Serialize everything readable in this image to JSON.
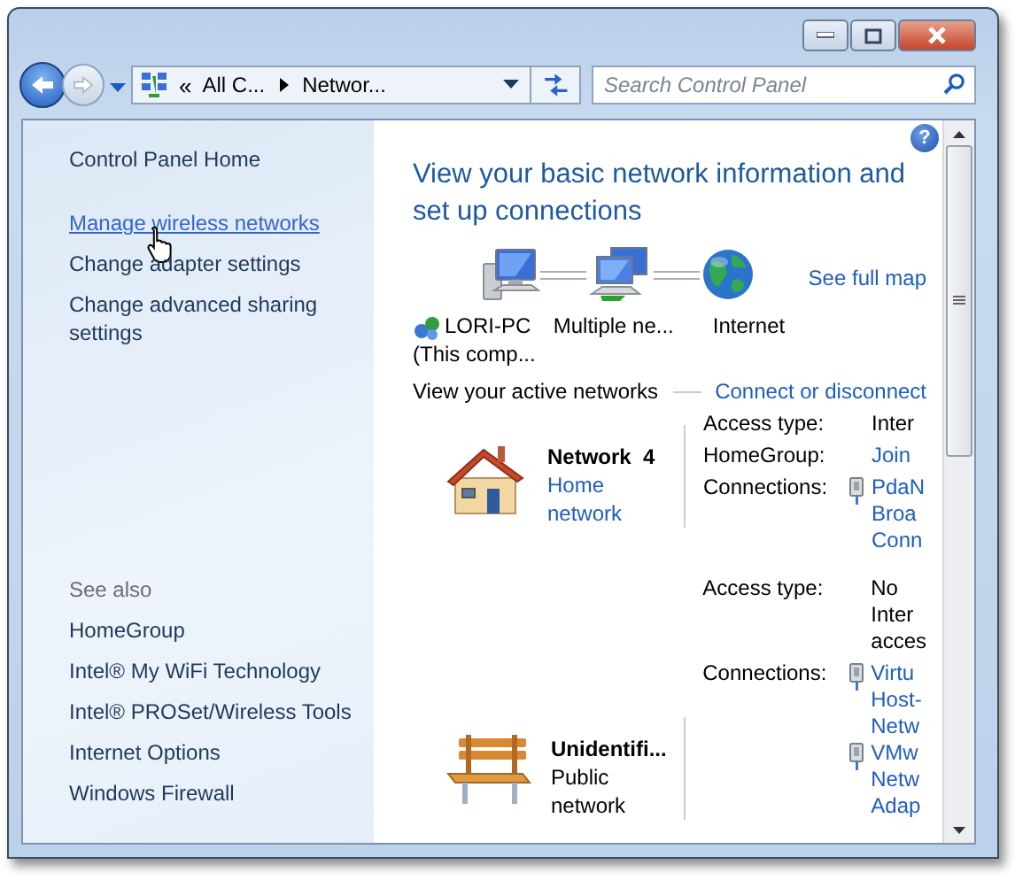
{
  "address_bar": {
    "overflow": "«",
    "crumbs": [
      "All C...",
      "Networ..."
    ]
  },
  "search": {
    "placeholder": "Search Control Panel"
  },
  "help": "?",
  "sidebar": {
    "items": [
      {
        "label": "Control Panel Home",
        "hovered": false
      },
      {
        "label": "Manage wireless networks",
        "hovered": true
      },
      {
        "label": "Change adapter settings",
        "hovered": false
      },
      {
        "label": "Change advanced sharing settings",
        "hovered": false
      }
    ],
    "see_also": {
      "heading": "See also",
      "items": [
        "HomeGroup",
        "Intel® My WiFi Technology",
        "Intel® PROSet/Wireless Tools",
        "Internet Options",
        "Windows Firewall"
      ]
    }
  },
  "main": {
    "title": "View your basic network information and set up connections",
    "map": {
      "nodes": [
        {
          "kind": "computer",
          "lines": [
            "LORI-PC",
            "(This comp..."
          ]
        },
        {
          "kind": "networks",
          "lines": [
            "Multiple ne..."
          ]
        },
        {
          "kind": "internet",
          "lines": [
            "Internet"
          ]
        }
      ],
      "full_map_link": "See full map"
    },
    "active": {
      "heading": "View your active networks",
      "link": "Connect or disconnect"
    },
    "networks": [
      {
        "kind": "home",
        "name": "Network  4",
        "type": "Home network",
        "type_is_link": true,
        "details": [
          {
            "label": "Access type:",
            "entries": [
              {
                "kind": "text",
                "lines": [
                  "Inter"
                ]
              }
            ]
          },
          {
            "label": "HomeGroup:",
            "entries": [
              {
                "kind": "link",
                "lines": [
                  "Join"
                ]
              }
            ]
          },
          {
            "label": "Connections:",
            "entries": [
              {
                "kind": "adapter",
                "lines": [
                  "PdaN",
                  "Broa",
                  "Conn"
                ]
              }
            ]
          }
        ]
      },
      {
        "kind": "public",
        "name": "Unidentifi...",
        "type": "Public network",
        "type_is_link": false,
        "details": [
          {
            "label": "Access type:",
            "entries": [
              {
                "kind": "text",
                "lines": [
                  "No",
                  "Inter",
                  "acces"
                ]
              }
            ]
          },
          {
            "label": "Connections:",
            "entries": [
              {
                "kind": "adapter",
                "lines": [
                  "Virtu",
                  "Host-",
                  "Netw"
                ]
              },
              {
                "kind": "adapter",
                "lines": [
                  "VMw",
                  "Netw",
                  "Adap"
                ]
              }
            ]
          }
        ]
      }
    ]
  }
}
